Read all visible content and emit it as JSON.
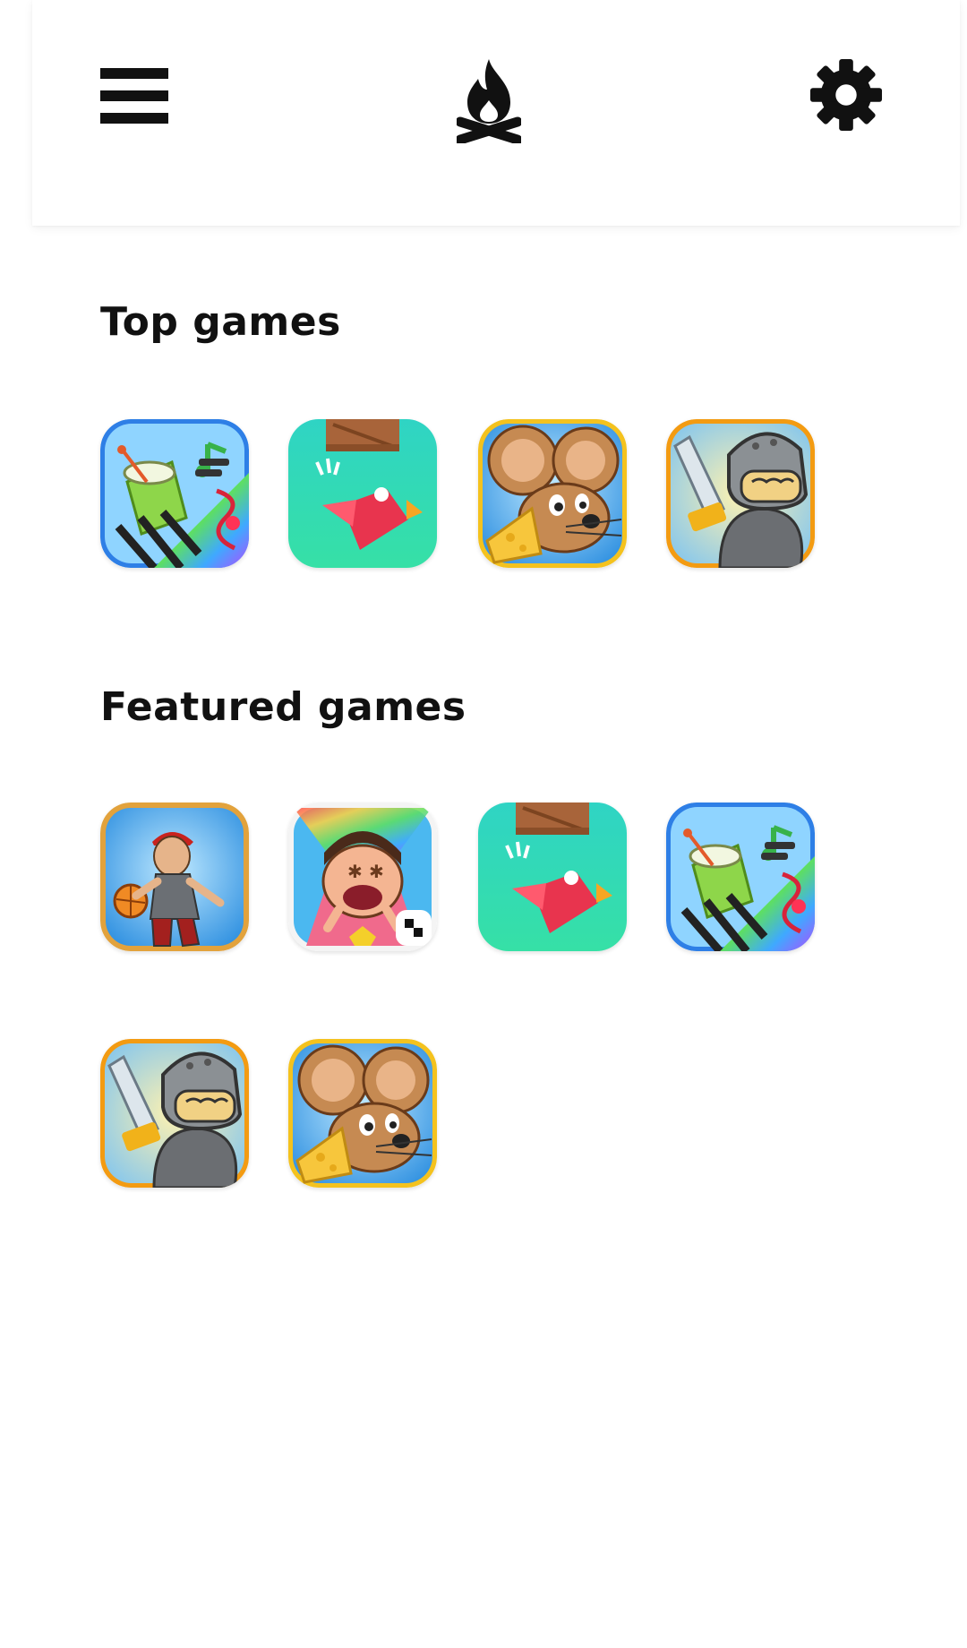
{
  "header": {
    "menu_icon": "hamburger-menu-icon",
    "logo_icon": "campfire-icon",
    "settings_icon": "gear-icon"
  },
  "sections": {
    "top_games": {
      "title": "Top games",
      "games": [
        "music-instruments",
        "red-bird",
        "cheese-mouse",
        "helmet-knight"
      ]
    },
    "featured_games": {
      "title": "Featured games",
      "games": [
        "street-basketball",
        "cartoon-hero",
        "red-bird",
        "music-instruments",
        "helmet-knight",
        "cheese-mouse"
      ]
    }
  }
}
